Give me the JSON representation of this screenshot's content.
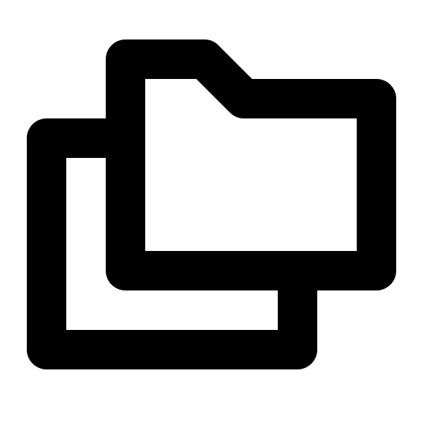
{
  "icon": {
    "name": "folders-icon",
    "stroke_color": "#000000",
    "background_color": "#ffffff"
  }
}
